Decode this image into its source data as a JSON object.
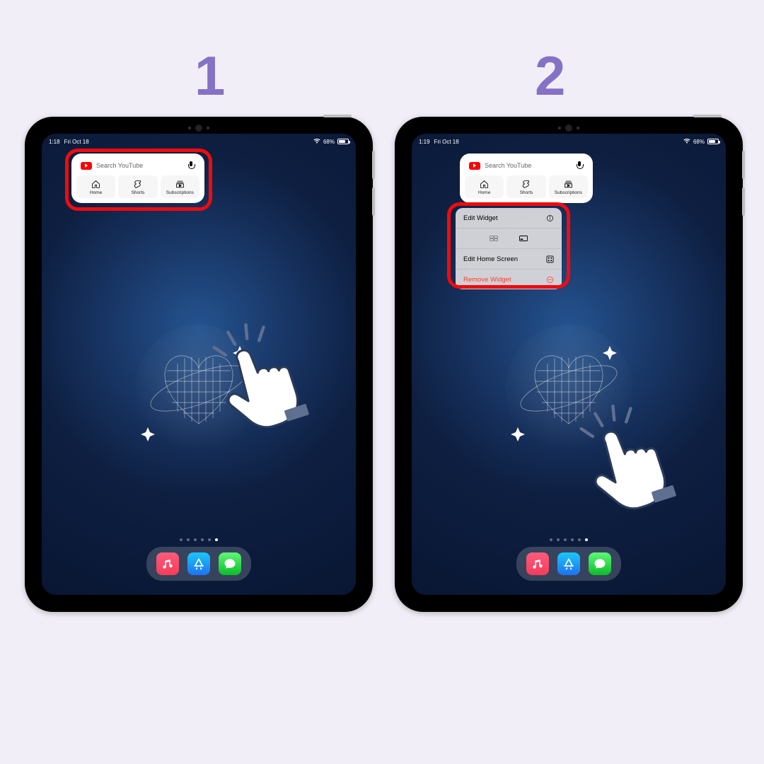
{
  "steps": {
    "one": "1",
    "two": "2"
  },
  "status": {
    "time1": "1:18",
    "time2": "1:19",
    "date": "Fri Oct 18",
    "battery": "68%",
    "wifi": "wifi"
  },
  "widget": {
    "search_placeholder": "Search YouTube",
    "pills": [
      {
        "label": "Home"
      },
      {
        "label": "Shorts"
      },
      {
        "label": "Subscriptions"
      }
    ]
  },
  "ctxmenu": {
    "edit_widget": "Edit Widget",
    "edit_home": "Edit Home Screen",
    "remove": "Remove Widget"
  },
  "dock": {
    "music": "Music",
    "appstore": "App Store",
    "messages": "Messages"
  }
}
